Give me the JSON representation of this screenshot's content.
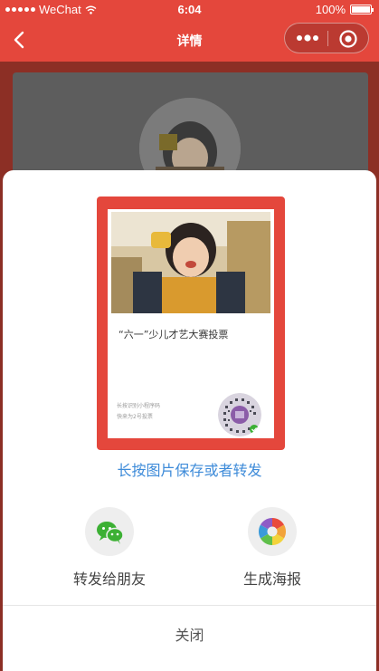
{
  "status_bar": {
    "carrier": "WeChat",
    "time": "6:04",
    "battery": "100%"
  },
  "nav": {
    "title": "详情"
  },
  "poster": {
    "title": "“六一”少儿才艺大赛投票",
    "hint_line1": "长按识别小程序码",
    "hint_line2": "快来为2号投票"
  },
  "save_hint": "长按图片保存或者转发",
  "actions": [
    {
      "label": "转发给朋友",
      "icon": "wechat-icon"
    },
    {
      "label": "生成海报",
      "icon": "aperture-icon"
    }
  ],
  "close_label": "关闭",
  "colors": {
    "primary": "#e4473c",
    "link": "#3e8bd9",
    "wechat_green": "#3cb034"
  }
}
